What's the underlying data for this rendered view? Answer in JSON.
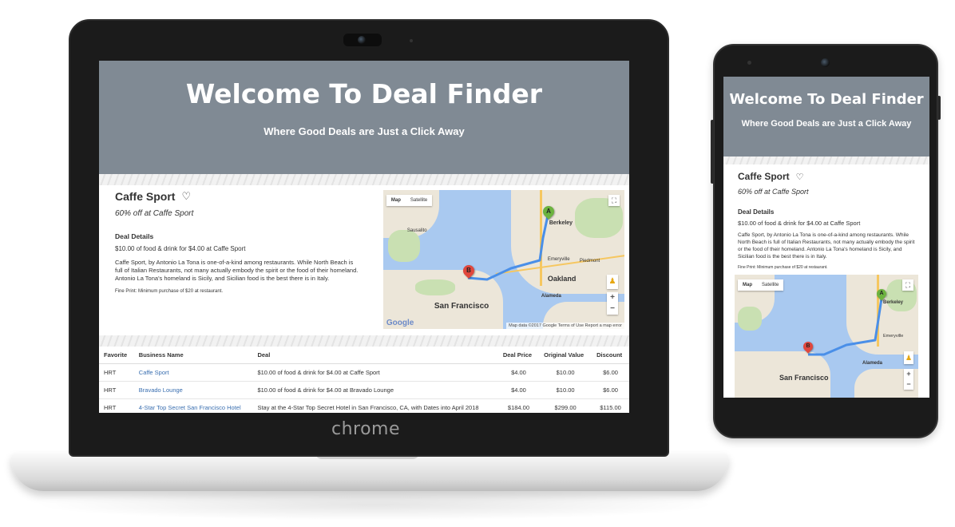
{
  "laptop": {
    "brand": "chrome"
  },
  "hero": {
    "title": "Welcome To Deal Finder",
    "subtitle": "Where Good Deals are Just a Click Away"
  },
  "deal": {
    "title": "Caffe Sport",
    "heart_icon": "heart-outline-icon",
    "subtitle": "60% off at Caffe Sport",
    "details_heading": "Deal Details",
    "details_summary": "$10.00 of food & drink for $4.00 at Caffe Sport",
    "description": "Caffe Sport, by Antonio La Tona is one-of-a-kind among restaurants. While North Beach is full of Italian Restaurants, not many actually embody the spirit or the food of their homeland. Antonio La Tona's homeland is Sicily, and Sicilian food is the best there is in Italy.",
    "fine_print": "Fine Print: Minimum purchase of $20 at restaurant."
  },
  "map": {
    "tab_map": "Map",
    "tab_satellite": "Satellite",
    "marker_a": "A",
    "marker_b": "B",
    "label_sf": "San Francisco",
    "label_oakland": "Oakland",
    "label_berkeley": "Berkeley",
    "label_alameda": "Alameda",
    "label_emeryville": "Emeryville",
    "label_piedmont": "Piedmont",
    "label_sausalito": "Sausalito",
    "zoom_in": "+",
    "zoom_out": "−",
    "google": "Google",
    "attribution": "Map data ©2017 Google  Terms of Use  Report a map error",
    "colors": {
      "water": "#a9c9f0",
      "land": "#ece6d9",
      "route": "#4a8fe8",
      "marker_a": "#6cb33f",
      "marker_b": "#e0473d"
    }
  },
  "table": {
    "headers": [
      "Favorite",
      "Business Name",
      "Deal",
      "Deal Price",
      "Original Value",
      "Discount"
    ],
    "rows": [
      {
        "favorite": "HRT",
        "business": "Caffe Sport",
        "deal": "$10.00 of food & drink for $4.00 at Caffe Sport",
        "price": "$4.00",
        "original": "$10.00",
        "discount": "$6.00"
      },
      {
        "favorite": "HRT",
        "business": "Bravado Lounge",
        "deal": "$10.00 of food & drink for $4.00 at Bravado Lounge",
        "price": "$4.00",
        "original": "$10.00",
        "discount": "$6.00"
      },
      {
        "favorite": "HRT",
        "business": "4-Star Top Secret San Francisco Hotel",
        "deal": "Stay at the 4-Star Top Secret Hotel in San Francisco, CA, with Dates into April 2018",
        "price": "$184.00",
        "original": "$299.00",
        "discount": "$115.00"
      }
    ]
  },
  "phone": {
    "fine_print": "Fine Print: Minimum purchase of $20 at restaurant."
  }
}
